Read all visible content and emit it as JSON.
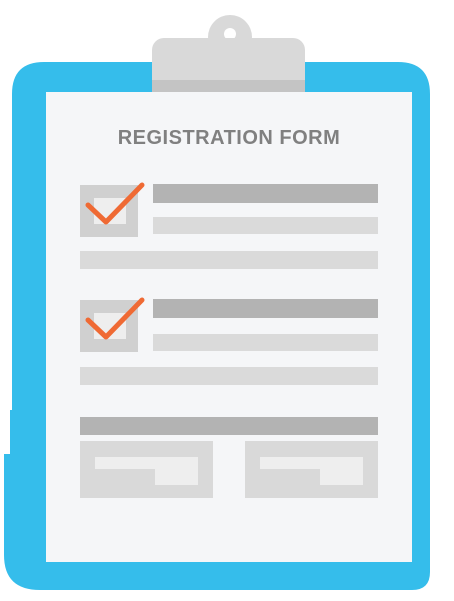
{
  "form": {
    "title": "REGISTRATION FORM"
  },
  "items": [
    {
      "checked": true
    },
    {
      "checked": true
    }
  ],
  "colors": {
    "frame": "#35bdeb",
    "paper": "#f5f6f8",
    "clip": "#d9d9d9",
    "line_dark": "#b3b3b3",
    "line_light": "#dadada",
    "check": "#ef6a34"
  },
  "icons": {
    "clipboard": "clipboard-icon",
    "checkmark": "checkmark-icon",
    "clip": "clip-icon"
  }
}
